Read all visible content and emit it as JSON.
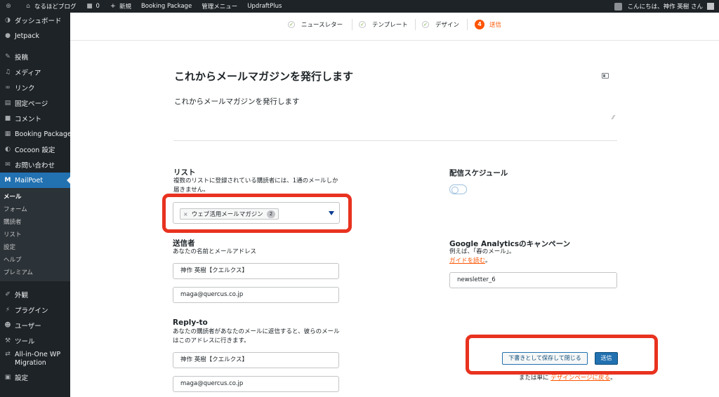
{
  "admin_bar": {
    "site_name": "なるほどブログ",
    "comments_count": "0",
    "new_label": "新規",
    "booking": "Booking Package",
    "admin_menu": "管理メニュー",
    "updraft": "UpdraftPlus",
    "greeting": "こんにちは、神作 英樹 さん"
  },
  "sidebar": {
    "items_top": [
      {
        "label": "ダッシュボード",
        "icon": "dashboard-icon"
      },
      {
        "label": "Jetpack",
        "icon": "jetpack-icon"
      }
    ],
    "items_mid": [
      {
        "label": "投稿",
        "icon": "pin-icon"
      },
      {
        "label": "メディア",
        "icon": "media-icon"
      },
      {
        "label": "リンク",
        "icon": "link-icon"
      },
      {
        "label": "固定ページ",
        "icon": "page-icon"
      },
      {
        "label": "コメント",
        "icon": "comment-icon"
      },
      {
        "label": "Booking Package",
        "icon": "booking-icon"
      },
      {
        "label": "Cocoon 設定",
        "icon": "cocoon-icon"
      },
      {
        "label": "お問い合わせ",
        "icon": "mail-icon"
      }
    ],
    "active": {
      "label": "MailPoet",
      "icon": "mailpoet-icon"
    },
    "submenu": [
      "メール",
      "フォーム",
      "購読者",
      "リスト",
      "設定",
      "ヘルプ",
      "プレミアム"
    ],
    "items_bottom": [
      {
        "label": "外観",
        "icon": "appearance-icon"
      },
      {
        "label": "プラグイン",
        "icon": "plugin-icon"
      },
      {
        "label": "ユーザー",
        "icon": "user-icon"
      },
      {
        "label": "ツール",
        "icon": "tools-icon"
      },
      {
        "label": "All-in-One WP Migration",
        "icon": "migration-icon"
      },
      {
        "label": "設定",
        "icon": "settings-icon"
      }
    ]
  },
  "steps": [
    {
      "label": "ニュースレター",
      "state": "done"
    },
    {
      "label": "テンプレート",
      "state": "done"
    },
    {
      "label": "デザイン",
      "state": "done"
    },
    {
      "label": "送信",
      "state": "active",
      "number": "4"
    }
  ],
  "email": {
    "subject": "これからメールマガジンを発行します",
    "preheader": "これからメールマガジンを発行します"
  },
  "list": {
    "label": "リスト",
    "description": "複数のリストに登録されている購読者には、1通のメールしか届きません。",
    "selected_tag": "ウェブ活用メールマガジン",
    "selected_count": "2"
  },
  "sender": {
    "label": "送信者",
    "description": "あなたの名前とメールアドレス",
    "name": "神作 英樹【クエルクス】",
    "email": "maga@quercus.co.jp"
  },
  "reply_to": {
    "label": "Reply-to",
    "description": "あなたの購読者があなたのメールに返信すると、彼らのメールはこのアドレスに行きます。",
    "name": "神作 英樹【クエルクス】",
    "email": "maga@quercus.co.jp"
  },
  "schedule": {
    "label": "配信スケジュール",
    "enabled": false
  },
  "ga": {
    "label": "Google Analyticsのキャンペーン",
    "example": "例えば、「春のメール」。",
    "guide_link": "ガイドを読む",
    "guide_suffix": "。",
    "value": "newsletter_6"
  },
  "actions": {
    "save_close": "下書きとして保存して閉じる",
    "send": "送信",
    "or_text": "または単に",
    "back_link": "デザインページに戻る",
    "back_suffix": "。"
  },
  "colors": {
    "accent": "#fe5301",
    "wp_blue": "#2271b1",
    "highlight": "#e8321f"
  }
}
